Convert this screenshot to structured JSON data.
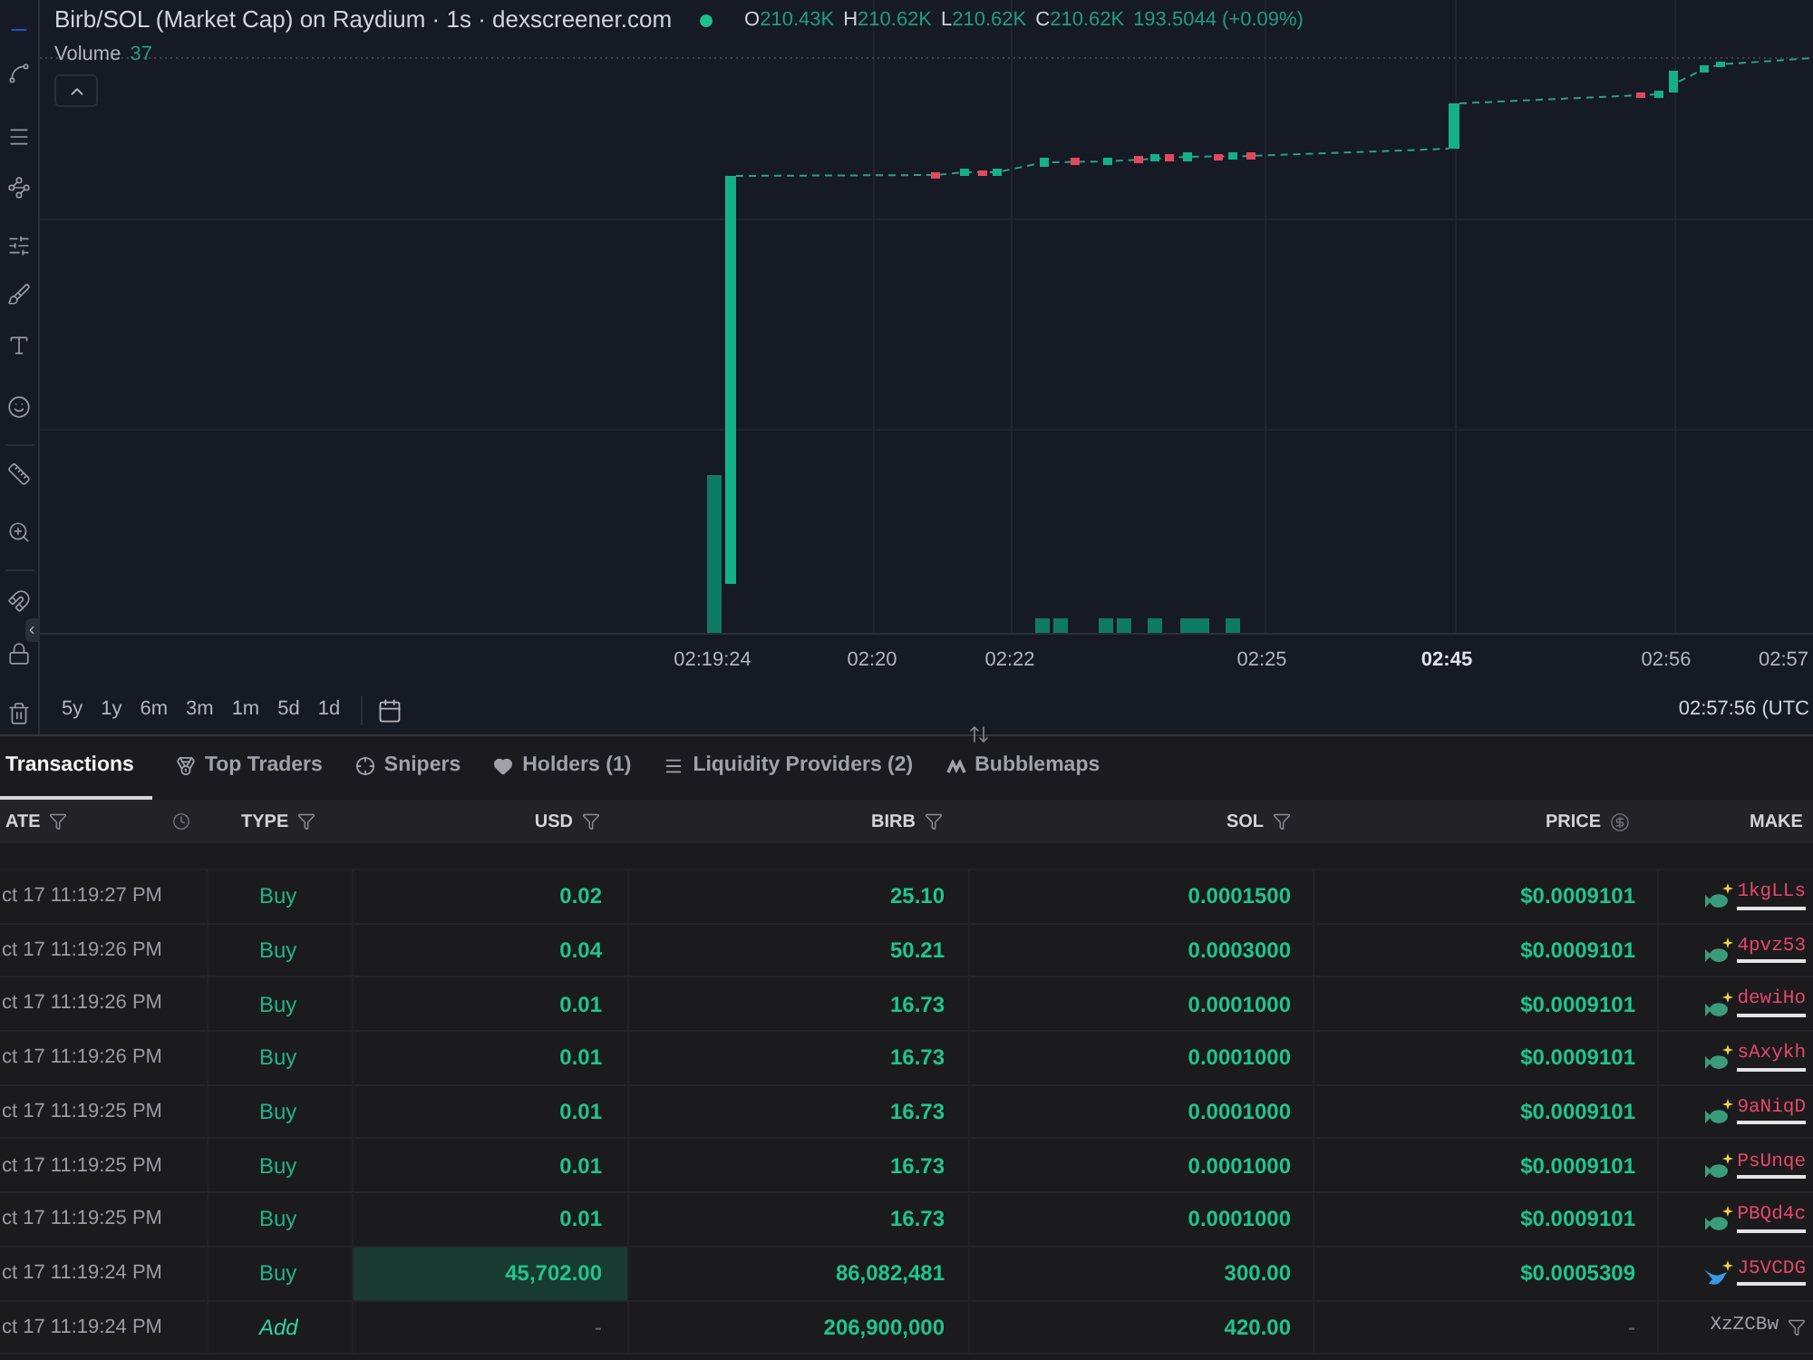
{
  "chart": {
    "title": "Birb/SOL (Market Cap) on Raydium · 1s · dexscreener.com",
    "ohlc": [
      {
        "label": "O",
        "value": "210.43K"
      },
      {
        "label": "H",
        "value": "210.62K"
      },
      {
        "label": "L",
        "value": "210.62K"
      },
      {
        "label": "C",
        "value": "210.62K"
      }
    ],
    "change": "193.5044 (+0.09%)",
    "volume": {
      "label": "Volume",
      "value": "37"
    },
    "time_axis": [
      {
        "text": "02:19:24",
        "emphasized": false
      },
      {
        "text": "02:20",
        "emphasized": false
      },
      {
        "text": "02:22",
        "emphasized": false
      },
      {
        "text": "02:25",
        "emphasized": false
      },
      {
        "text": "02:45",
        "emphasized": true
      },
      {
        "text": "02:56",
        "emphasized": false
      },
      {
        "text": "02:57",
        "emphasized": false
      }
    ]
  },
  "range_bar": {
    "ranges": [
      {
        "label": "5y",
        "selected": false
      },
      {
        "label": "1y",
        "selected": false
      },
      {
        "label": "6m",
        "selected": false
      },
      {
        "label": "3m",
        "selected": false
      },
      {
        "label": "1m",
        "selected": false
      },
      {
        "label": "5d",
        "selected": false
      },
      {
        "label": "1d",
        "selected": false
      }
    ],
    "clock": "02:57:56 (UTC"
  },
  "tabs": [
    {
      "label": "Transactions",
      "selected": true
    },
    {
      "label": "Top Traders",
      "selected": false
    },
    {
      "label": "Snipers",
      "selected": false
    },
    {
      "label": "Holders (1)",
      "selected": false
    },
    {
      "label": "Liquidity Providers (2)",
      "selected": false
    },
    {
      "label": "Bubblemaps",
      "selected": false
    }
  ],
  "table": {
    "columns": [
      {
        "label": "ATE",
        "kind": "date"
      },
      {
        "label": "TYPE",
        "kind": "filter"
      },
      {
        "label": "USD",
        "kind": "filter"
      },
      {
        "label": "BIRB",
        "kind": "filter"
      },
      {
        "label": "SOL",
        "kind": "filter"
      },
      {
        "label": "PRICE",
        "kind": "currency"
      },
      {
        "label": "MAKE",
        "kind": "plain"
      }
    ],
    "rows": [
      {
        "kind": "buy",
        "date": "ct 17 11:19:27 PM",
        "type": "Buy",
        "usd": "0.02",
        "birb": "25.10",
        "sol": "0.0001500",
        "price": "$0.0009101",
        "maker": {
          "address": "1kgLLs",
          "kind": "small"
        },
        "usd_highlight": false
      },
      {
        "kind": "buy",
        "date": "ct 17 11:19:26 PM",
        "type": "Buy",
        "usd": "0.04",
        "birb": "50.21",
        "sol": "0.0003000",
        "price": "$0.0009101",
        "maker": {
          "address": "4pvz53",
          "kind": "small"
        },
        "usd_highlight": false
      },
      {
        "kind": "buy",
        "date": "ct 17 11:19:26 PM",
        "type": "Buy",
        "usd": "0.01",
        "birb": "16.73",
        "sol": "0.0001000",
        "price": "$0.0009101",
        "maker": {
          "address": "dewiHo",
          "kind": "small"
        },
        "usd_highlight": false
      },
      {
        "kind": "buy",
        "date": "ct 17 11:19:26 PM",
        "type": "Buy",
        "usd": "0.01",
        "birb": "16.73",
        "sol": "0.0001000",
        "price": "$0.0009101",
        "maker": {
          "address": "sAxykh",
          "kind": "small"
        },
        "usd_highlight": false
      },
      {
        "kind": "buy",
        "date": "ct 17 11:19:25 PM",
        "type": "Buy",
        "usd": "0.01",
        "birb": "16.73",
        "sol": "0.0001000",
        "price": "$0.0009101",
        "maker": {
          "address": "9aNiqD",
          "kind": "small"
        },
        "usd_highlight": false
      },
      {
        "kind": "buy",
        "date": "ct 17 11:19:25 PM",
        "type": "Buy",
        "usd": "0.01",
        "birb": "16.73",
        "sol": "0.0001000",
        "price": "$0.0009101",
        "maker": {
          "address": "PsUnqe",
          "kind": "small"
        },
        "usd_highlight": false
      },
      {
        "kind": "buy",
        "date": "ct 17 11:19:25 PM",
        "type": "Buy",
        "usd": "0.01",
        "birb": "16.73",
        "sol": "0.0001000",
        "price": "$0.0009101",
        "maker": {
          "address": "PBQd4c",
          "kind": "small"
        },
        "usd_highlight": false
      },
      {
        "kind": "buy",
        "date": "ct 17 11:19:24 PM",
        "type": "Buy",
        "usd": "45,702.00",
        "birb": "86,082,481",
        "sol": "300.00",
        "price": "$0.0005309",
        "maker": {
          "address": "J5VCDG",
          "kind": "large"
        },
        "usd_highlight": true
      },
      {
        "kind": "add",
        "date": "ct 17 11:19:24 PM",
        "type": "Add",
        "usd": "-",
        "birb": "206,900,000",
        "sol": "420.00",
        "price": "-",
        "maker": {
          "address": "XzZCBw",
          "kind": "pool"
        },
        "usd_highlight": false
      }
    ]
  }
}
